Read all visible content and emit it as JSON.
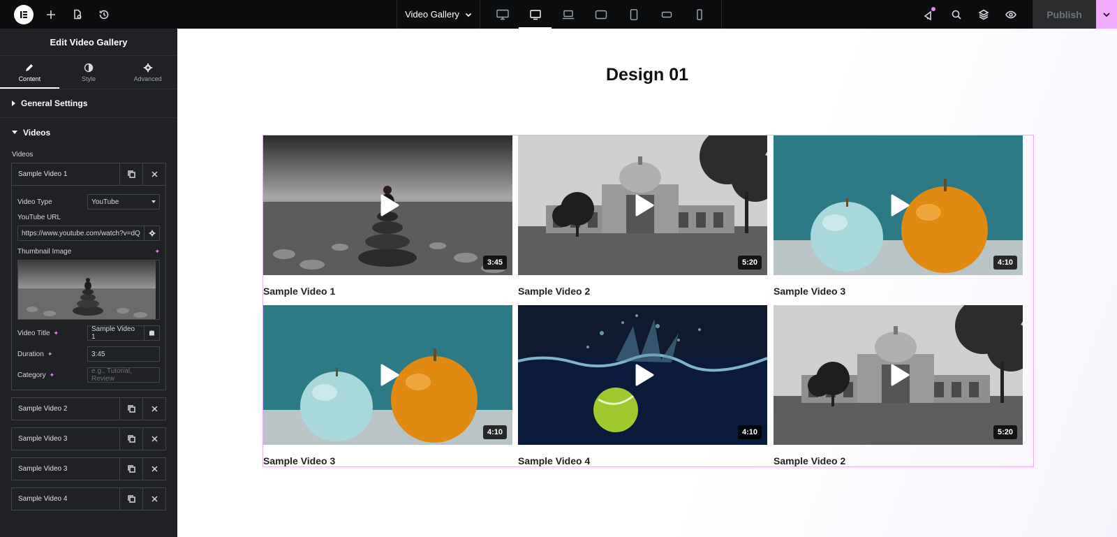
{
  "topbar": {
    "document_title": "Video Gallery",
    "publish_label": "Publish",
    "devices": [
      "desktop",
      "tablet-landscape",
      "laptop",
      "tablet-extra",
      "tablet",
      "mobile-extra",
      "mobile"
    ]
  },
  "panel": {
    "header": "Edit Video Gallery",
    "tabs": {
      "content": "Content",
      "style": "Style",
      "advanced": "Advanced"
    },
    "general_settings": "General Settings",
    "videos_section": "Videos",
    "videos_label": "Videos",
    "items": [
      {
        "name": "Sample Video 1"
      },
      {
        "name": "Sample Video 2"
      },
      {
        "name": "Sample Video 3"
      },
      {
        "name": "Sample Video 3"
      },
      {
        "name": "Sample Video 4"
      }
    ],
    "editor": {
      "video_type_label": "Video Type",
      "video_type_value": "YouTube",
      "url_label": "YouTube URL",
      "url_value": "https://www.youtube.com/watch?v=dQ",
      "thumbnail_label": "Thumbnail Image",
      "title_label": "Video Title",
      "title_value": "Sample Video 1",
      "duration_label": "Duration",
      "duration_value": "3:45",
      "category_label": "Category",
      "category_placeholder": "e.g., Tutorial, Review"
    }
  },
  "canvas": {
    "title": "Design 01",
    "videos": [
      {
        "title": "Sample Video 1",
        "duration": "3:45",
        "scene": "stones"
      },
      {
        "title": "Sample Video 2",
        "duration": "5:20",
        "scene": "monument"
      },
      {
        "title": "Sample Video 3",
        "duration": "4:10",
        "scene": "apples"
      },
      {
        "title": "Sample Video 3",
        "duration": "4:10",
        "scene": "apples"
      },
      {
        "title": "Sample Video 4",
        "duration": "4:10",
        "scene": "ball"
      },
      {
        "title": "Sample Video 2",
        "duration": "5:20",
        "scene": "monument"
      }
    ]
  },
  "colors": {
    "accent": "#f0abfc",
    "panel_bg": "#1f2124",
    "topbar_bg": "#0c0d0e"
  }
}
